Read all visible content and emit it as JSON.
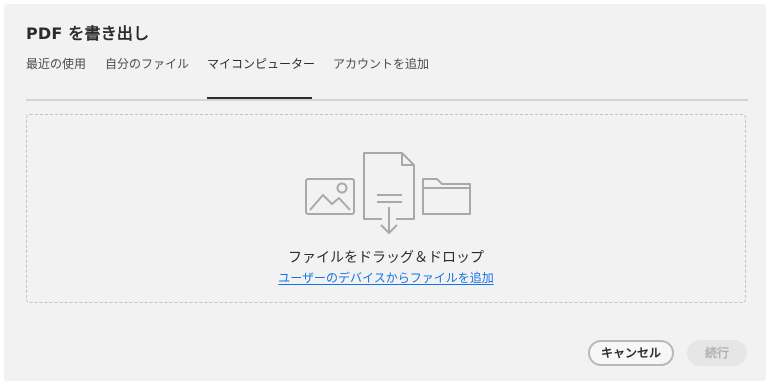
{
  "dialog": {
    "title": "PDF を書き出し"
  },
  "tabs": [
    {
      "label": "最近の使用"
    },
    {
      "label": "自分のファイル"
    },
    {
      "label": "マイコンピューター",
      "active": true
    },
    {
      "label": "アカウントを追加"
    }
  ],
  "dropzone": {
    "title": "ファイルをドラッグ＆ドロップ",
    "link": "ユーザーのデバイスからファイルを追加",
    "icons": [
      "image-icon",
      "document-download-icon",
      "folder-icon"
    ]
  },
  "footer": {
    "cancel_label": "キャンセル",
    "continue_label": "続行",
    "continue_disabled": true
  },
  "colors": {
    "link": "#1473e6",
    "dialog_bg": "#f2f2f2",
    "active_tab_underline": "#2c2c2c"
  }
}
